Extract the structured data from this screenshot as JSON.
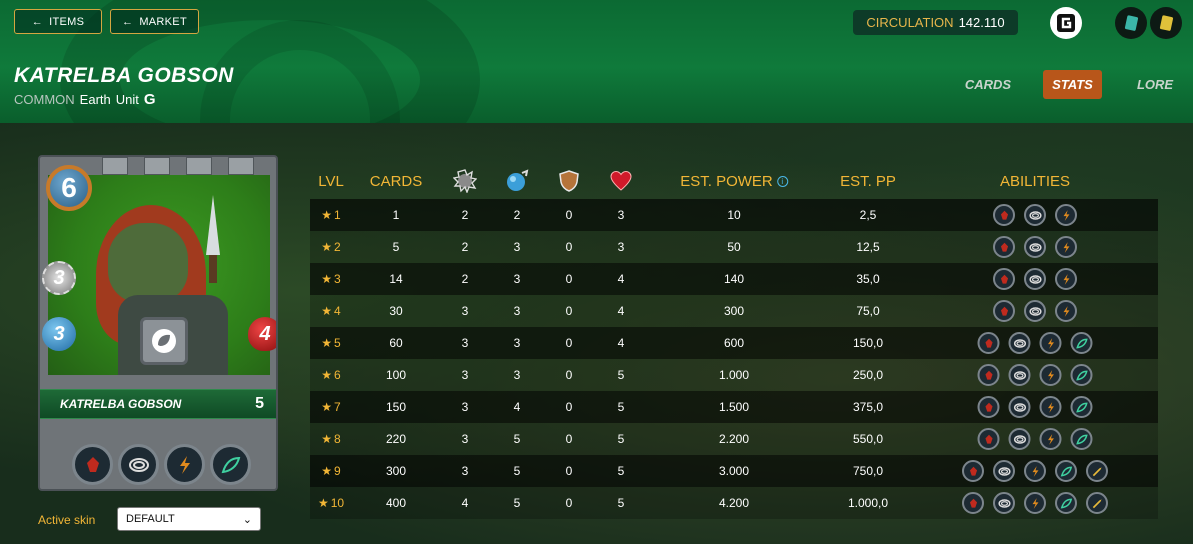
{
  "nav": {
    "items_label": "ITEMS",
    "market_label": "MARKET"
  },
  "circulation": {
    "label": "CIRCULATION",
    "value": "142.110"
  },
  "card": {
    "name": "KATRELBA GOBSON",
    "rarity": "COMMON",
    "element": "Earth",
    "type": "Unit",
    "mana": "6",
    "melee": "3",
    "magic": "3",
    "health": "4",
    "level": "5",
    "edition_glyph": "G"
  },
  "tabs": {
    "cards": "CARDS",
    "stats": "STATS",
    "lore": "LORE",
    "active": "stats"
  },
  "skin": {
    "label": "Active skin",
    "selected": "DEFAULT"
  },
  "table": {
    "headers": {
      "lvl": "LVL",
      "cards": "CARDS",
      "est_power": "EST. POWER",
      "est_pp": "EST. PP",
      "abilities": "ABILITIES",
      "icon_melee": "melee-attack-icon",
      "icon_magic": "magic-attack-icon",
      "icon_armor": "armor-icon",
      "icon_health": "health-icon"
    },
    "ability_icons": [
      "demoralize-icon",
      "snare-icon",
      "thorns-icon",
      "heal-icon",
      "blast-icon"
    ],
    "rows": [
      {
        "lvl": "1",
        "cards": "1",
        "melee": "2",
        "magic": "2",
        "armor": "0",
        "health": "3",
        "power": "10",
        "pp": "2,5",
        "abilities": 3
      },
      {
        "lvl": "2",
        "cards": "5",
        "melee": "2",
        "magic": "3",
        "armor": "0",
        "health": "3",
        "power": "50",
        "pp": "12,5",
        "abilities": 3
      },
      {
        "lvl": "3",
        "cards": "14",
        "melee": "2",
        "magic": "3",
        "armor": "0",
        "health": "4",
        "power": "140",
        "pp": "35,0",
        "abilities": 3
      },
      {
        "lvl": "4",
        "cards": "30",
        "melee": "3",
        "magic": "3",
        "armor": "0",
        "health": "4",
        "power": "300",
        "pp": "75,0",
        "abilities": 3
      },
      {
        "lvl": "5",
        "cards": "60",
        "melee": "3",
        "magic": "3",
        "armor": "0",
        "health": "4",
        "power": "600",
        "pp": "150,0",
        "abilities": 4
      },
      {
        "lvl": "6",
        "cards": "100",
        "melee": "3",
        "magic": "3",
        "armor": "0",
        "health": "5",
        "power": "1.000",
        "pp": "250,0",
        "abilities": 4
      },
      {
        "lvl": "7",
        "cards": "150",
        "melee": "3",
        "magic": "4",
        "armor": "0",
        "health": "5",
        "power": "1.500",
        "pp": "375,0",
        "abilities": 4
      },
      {
        "lvl": "8",
        "cards": "220",
        "melee": "3",
        "magic": "5",
        "armor": "0",
        "health": "5",
        "power": "2.200",
        "pp": "550,0",
        "abilities": 4
      },
      {
        "lvl": "9",
        "cards": "300",
        "melee": "3",
        "magic": "5",
        "armor": "0",
        "health": "5",
        "power": "3.000",
        "pp": "750,0",
        "abilities": 5
      },
      {
        "lvl": "10",
        "cards": "400",
        "melee": "4",
        "magic": "5",
        "armor": "0",
        "health": "5",
        "power": "4.200",
        "pp": "1.000,0",
        "abilities": 5
      }
    ]
  },
  "colors": {
    "accent": "#f2b636",
    "active_tab": "#b8561a",
    "header_green": "#0f7a3b"
  }
}
